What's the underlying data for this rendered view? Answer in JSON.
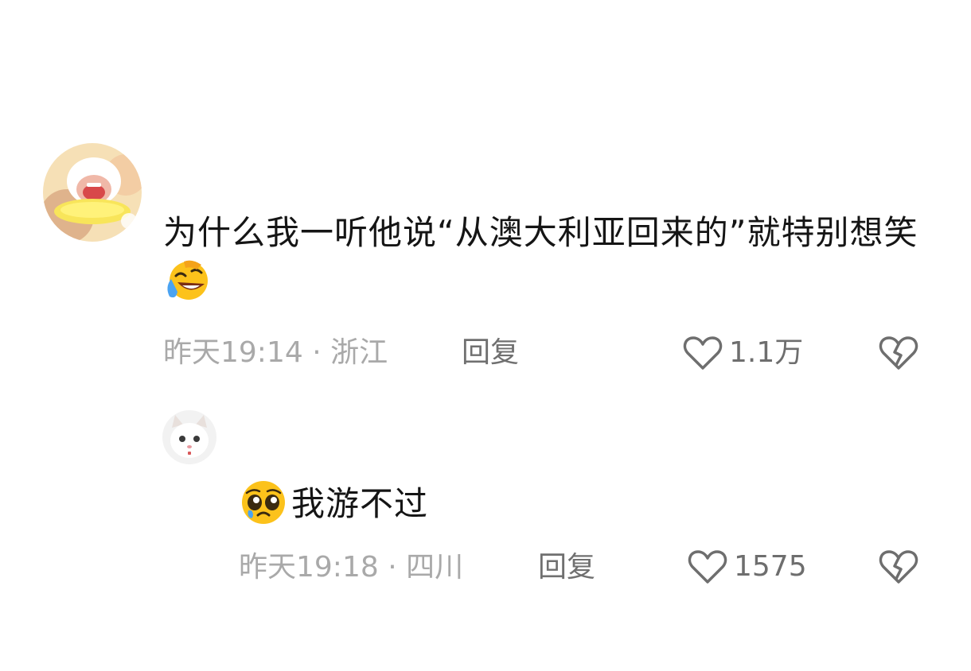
{
  "comments": [
    {
      "text": "为什么我一听他说“从澳大利亚回来的”就特别想笑",
      "emoji": "rolling-on-floor-laughing",
      "time": "昨天19:14",
      "location": "浙江",
      "reply_label": "回复",
      "likes": "1.1万"
    },
    {
      "emoji": "pleading-face",
      "text": "我游不过",
      "time": "昨天19:18",
      "location": "四川",
      "reply_label": "回复",
      "likes": "1575"
    }
  ],
  "separator": " · ",
  "icons": {
    "like": "heart-outline-icon",
    "dislike": "broken-heart-icon"
  },
  "colors": {
    "meta": "#a9a9a9",
    "action": "#6e6e6e",
    "text": "#151515"
  }
}
